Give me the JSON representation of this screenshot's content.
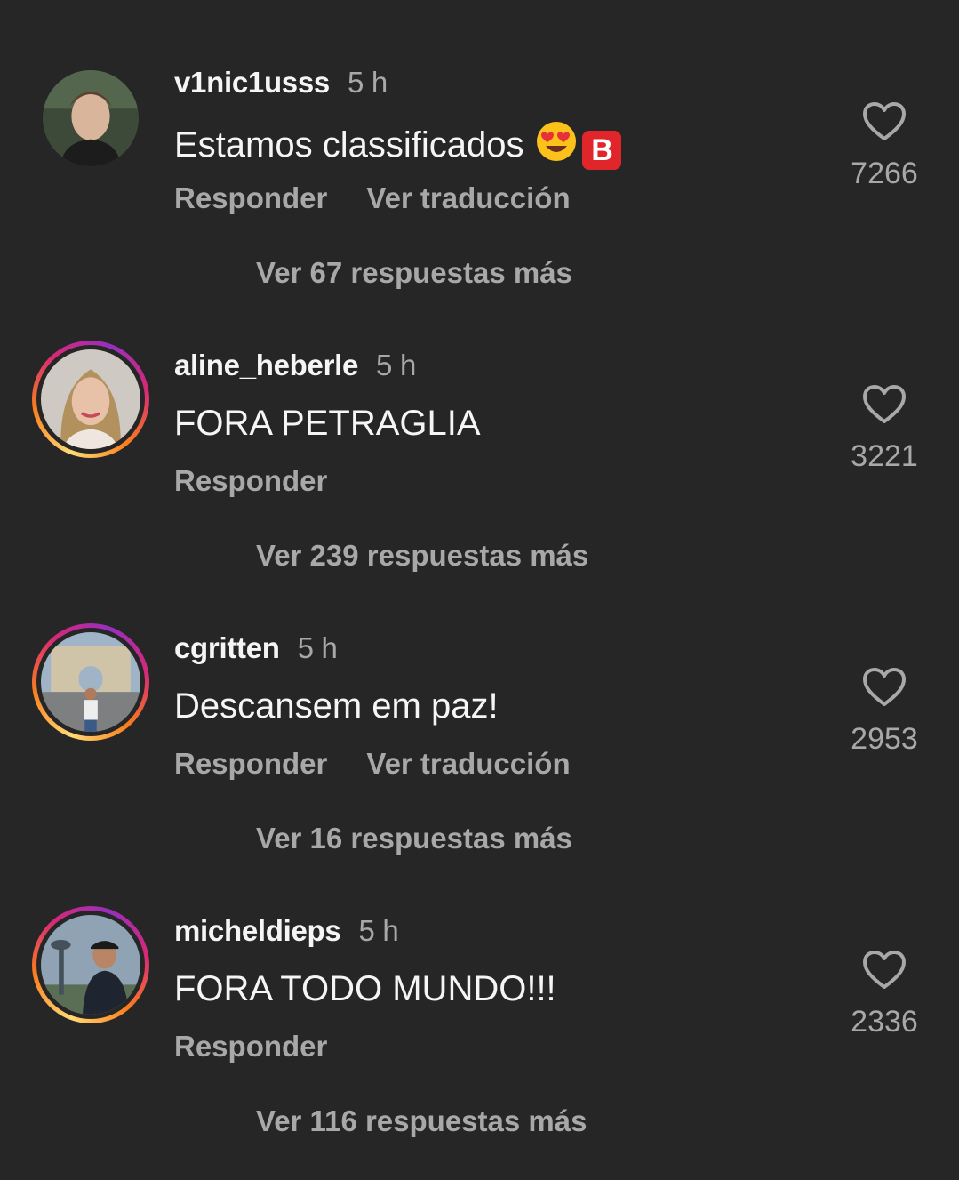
{
  "comments": [
    {
      "username": "v1nic1usss",
      "time": "5 h",
      "text": "Estamos classificados",
      "emojis": [
        "heart-eyes",
        "B"
      ],
      "reply_label": "Responder",
      "translate_label": "Ver traducción",
      "likes": "7266",
      "more_replies": "Ver 67 respuestas más",
      "story_ring": false
    },
    {
      "username": "aline_heberle",
      "time": "5 h",
      "text": "FORA PETRAGLIA",
      "reply_label": "Responder",
      "likes": "3221",
      "more_replies": "Ver 239 respuestas más",
      "story_ring": true
    },
    {
      "username": "cgritten",
      "time": "5 h",
      "text": "Descansem em paz!",
      "reply_label": "Responder",
      "translate_label": "Ver traducción",
      "likes": "2953",
      "more_replies": "Ver 16 respuestas más",
      "story_ring": true
    },
    {
      "username": "micheldieps",
      "time": "5 h",
      "text": "FORA TODO MUNDO!!!",
      "reply_label": "Responder",
      "likes": "2336",
      "more_replies": "Ver 116 respuestas más",
      "story_ring": true
    }
  ],
  "colors": {
    "background": "#262626",
    "primary_text": "#f5f5f5",
    "secondary_text": "#a8a8a8"
  }
}
